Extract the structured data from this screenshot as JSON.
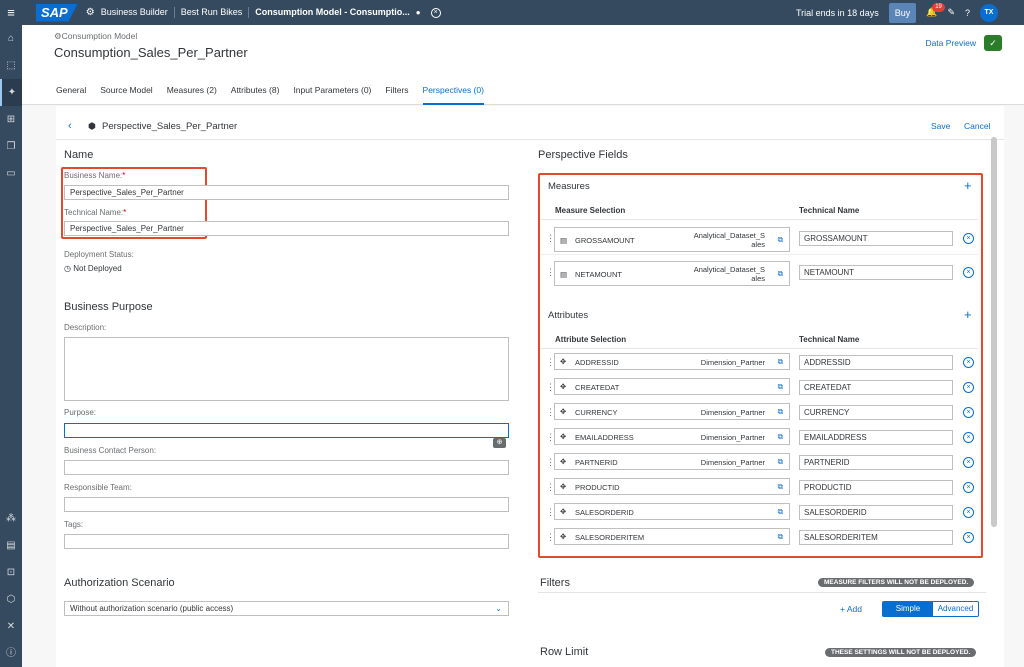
{
  "shell": {
    "brand": "SAP",
    "crumb1": "Business Builder",
    "crumb2": "Best Run Bikes",
    "crumb3": "Consumption Model - Consumptio...",
    "trial": "Trial ends in 18 days",
    "buy": "Buy",
    "notif_count": "19",
    "avatar": "TX"
  },
  "header": {
    "type": "Consumption Model",
    "title": "Consumption_Sales_Per_Partner",
    "data_preview": "Data Preview"
  },
  "tabs": [
    "General",
    "Source Model",
    "Measures (2)",
    "Attributes (8)",
    "Input Parameters (0)",
    "Filters",
    "Perspectives (0)"
  ],
  "sub": {
    "title": "Perspective_Sales_Per_Partner",
    "save": "Save",
    "cancel": "Cancel"
  },
  "left": {
    "name_title": "Name",
    "business_name_label": "Business Name:",
    "business_name": "Perspective_Sales_Per_Partner",
    "technical_name_label": "Technical Name:",
    "technical_name": "Perspective_Sales_Per_Partner",
    "deployment_label": "Deployment Status:",
    "deployment_value": "Not Deployed",
    "purpose_title": "Business Purpose",
    "description_label": "Description:",
    "purpose_label": "Purpose:",
    "contact_label": "Business Contact Person:",
    "team_label": "Responsible Team:",
    "tags_label": "Tags:",
    "auth_title": "Authorization Scenario",
    "auth_value": "Without authorization scenario (public access)"
  },
  "right": {
    "title": "Perspective Fields",
    "measures_title": "Measures",
    "measure_col": "Measure Selection",
    "tech_col": "Technical Name",
    "measures": [
      {
        "name": "GROSSAMOUNT",
        "source1": "Analytical_Dataset_S",
        "source2": "ales",
        "tech": "GROSSAMOUNT"
      },
      {
        "name": "NETAMOUNT",
        "source1": "Analytical_Dataset_S",
        "source2": "ales",
        "tech": "NETAMOUNT"
      }
    ],
    "attributes_title": "Attributes",
    "attr_col": "Attribute Selection",
    "attributes": [
      {
        "name": "ADDRESSID",
        "source": "Dimension_Partner",
        "tech": "ADDRESSID"
      },
      {
        "name": "CREATEDAT",
        "source": "",
        "tech": "CREATEDAT"
      },
      {
        "name": "CURRENCY",
        "source": "Dimension_Partner",
        "tech": "CURRENCY"
      },
      {
        "name": "EMAILADDRESS",
        "source": "Dimension_Partner",
        "tech": "EMAILADDRESS"
      },
      {
        "name": "PARTNERID",
        "source": "Dimension_Partner",
        "tech": "PARTNERID"
      },
      {
        "name": "PRODUCTID",
        "source": "",
        "tech": "PRODUCTID"
      },
      {
        "name": "SALESORDERID",
        "source": "",
        "tech": "SALESORDERID"
      },
      {
        "name": "SALESORDERITEM",
        "source": "",
        "tech": "SALESORDERITEM"
      }
    ],
    "filters_title": "Filters",
    "filters_badge": "MEASURE FILTERS WILL NOT BE DEPLOYED.",
    "add": "Add",
    "simple": "Simple",
    "advanced": "Advanced",
    "rowlimit_title": "Row Limit",
    "rowlimit_badge": "THESE SETTINGS WILL NOT BE DEPLOYED."
  }
}
